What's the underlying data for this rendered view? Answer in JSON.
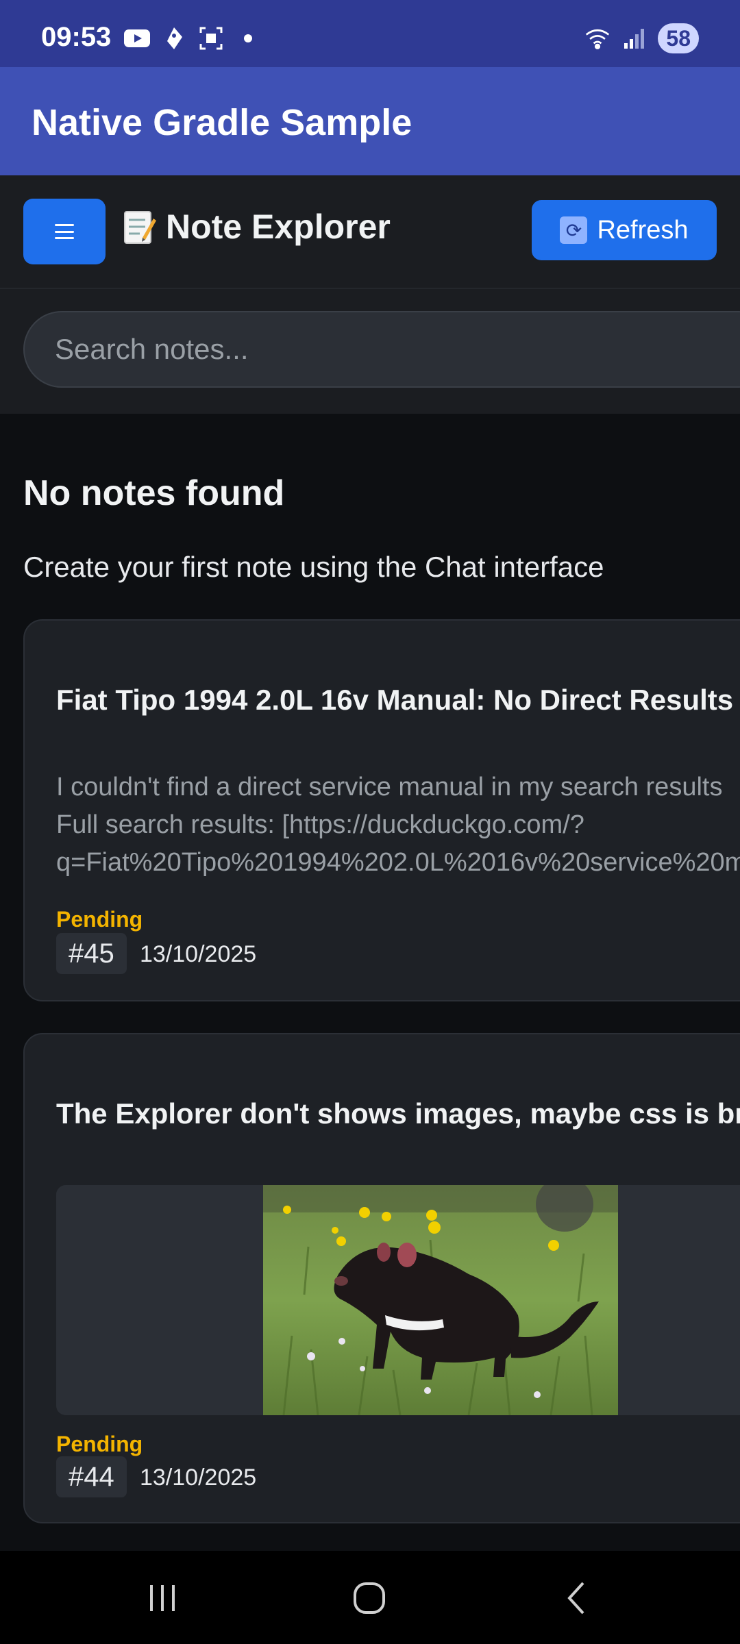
{
  "status_bar": {
    "time": "09:53",
    "battery": "58",
    "icons": [
      "youtube-icon",
      "tag-icon",
      "screenshot-icon",
      "dot-icon",
      "wifi-icon",
      "signal-icon"
    ]
  },
  "app_bar": {
    "title": "Native Gradle Sample"
  },
  "toolbar": {
    "menu_label": "☰",
    "explorer_title": "Note Explorer",
    "refresh_label": "Refresh"
  },
  "search": {
    "placeholder": "Search notes..."
  },
  "empty_state": {
    "title": "No notes found",
    "subtitle": "Create your first note using the Chat interface"
  },
  "notes": [
    {
      "title": "Fiat Tipo 1994 2.0L 16v Manual: No Direct Results",
      "body_lines": [
        "I couldn't find a direct service manual in my search results",
        "Full search results: [https://duckduckgo.com/?",
        "q=Fiat%20Tipo%201994%202.0L%2016v%20service%20m"
      ],
      "status": "Pending",
      "id": "#45",
      "date": "13/10/2025"
    },
    {
      "title": "The Explorer don't shows images, maybe css is br",
      "status": "Pending",
      "id": "#44",
      "date": "13/10/2025"
    }
  ],
  "colors": {
    "status_bar": "#2f3a94",
    "app_bar": "#3f51b5",
    "accent": "#1f6feb",
    "pending": "#f4b400",
    "background": "#0d0f12",
    "card": "#1e2126"
  }
}
